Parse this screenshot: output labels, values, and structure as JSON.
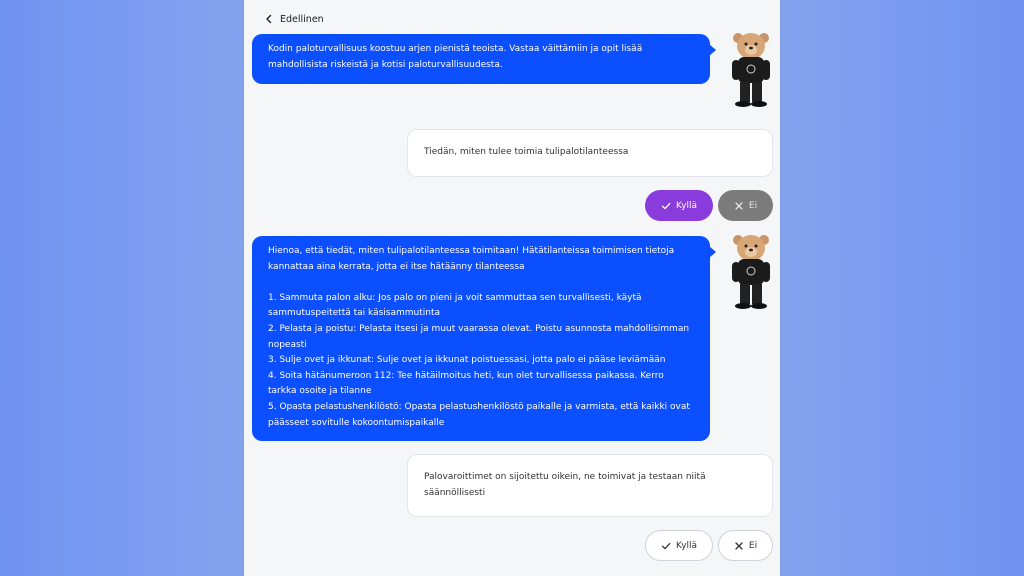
{
  "nav": {
    "back_label": "Edellinen"
  },
  "messages": {
    "intro": [
      "Kodin paloturvallisuus koostuu arjen pienistä teoista. Vastaa väittämiin ja opit lisää",
      "mahdollisista riskeistä ja kotisi paloturvallisuudesta."
    ],
    "feedback": [
      "Hienoa, että tiedät, miten tulipalotilanteessa toimitaan! Hätätilanteissa toimimisen tietoja",
      "kannattaa aina kerrata, jotta ei itse hätäänny tilanteessa",
      "",
      "1. Sammuta palon alku: Jos palo on pieni ja voit sammuttaa sen turvallisesti, käytä",
      "sammutuspeitettä tai käsisammutinta",
      "2. Pelasta ja poistu: Pelasta itsesi ja muut vaarassa olevat. Poistu asunnosta mahdollisimman",
      "nopeasti",
      "3. Sulje ovet ja ikkunat: Sulje ovet ja ikkunat poistuessasi, jotta palo ei pääse leviämään",
      "4. Soita hätänumeroon 112: Tee hätäilmoitus heti, kun olet turvallisessa paikassa. Kerro",
      "tarkka osoite ja tilanne",
      "5. Opasta pelastushenkilöstö: Opasta pelastushenkilöstö paikalle ja varmista, että kaikki ovat",
      "päässeet sovitulle kokoontumispaikalle"
    ]
  },
  "statements": [
    {
      "lines": [
        "Tiedän, miten tulee toimia tulipalotilanteessa"
      ],
      "yes_label": "Kyllä",
      "no_label": "Ei",
      "selected": "yes"
    },
    {
      "lines": [
        "Palovaroittimet on sijoitettu oikein, ne toimivat ja testaan niitä",
        "säännöllisesti"
      ],
      "yes_label": "Kyllä",
      "no_label": "Ei",
      "selected": null
    }
  ],
  "colors": {
    "bubble": "#0b4fff",
    "yes_selected": "#8a3bdc",
    "no_unselected": "#7b7b7b"
  },
  "icons": {
    "back": "chevron-left-icon",
    "yes": "check-icon",
    "no": "close-icon",
    "avatar": "bear-mascot-icon"
  }
}
